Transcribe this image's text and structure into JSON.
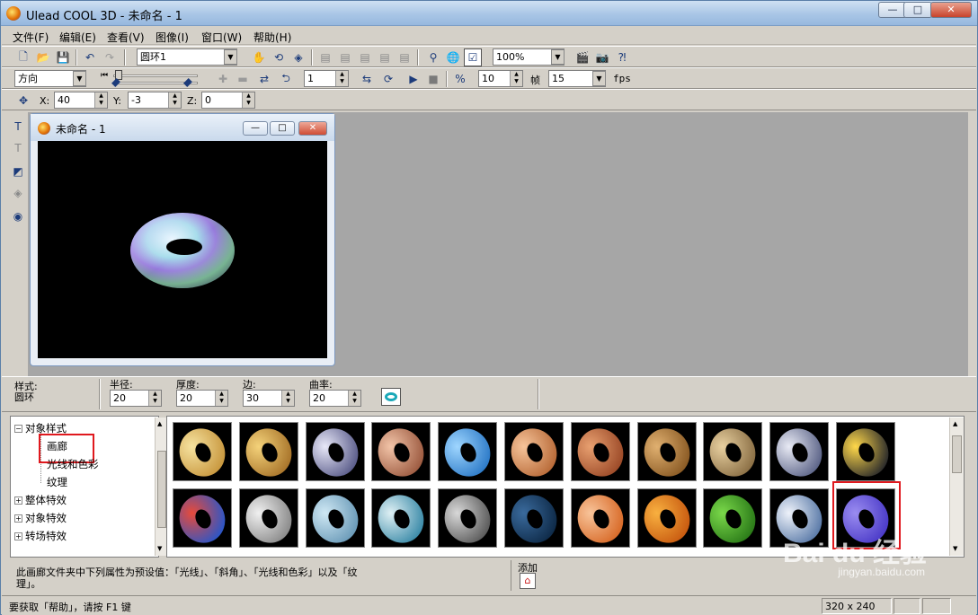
{
  "window": {
    "title": "Ulead COOL 3D - 未命名 - 1",
    "caption_buttons": [
      "—",
      "□",
      "✕"
    ]
  },
  "menu": [
    "文件(F)",
    "编辑(E)",
    "查看(V)",
    "图像(I)",
    "窗口(W)",
    "帮助(H)"
  ],
  "toolbar1": {
    "object_select": "圆环1",
    "zoom": "100%"
  },
  "toolbar2": {
    "mode_select": "方向",
    "frame_value": "1",
    "fps_value": "10",
    "frames_label": "帧",
    "frames_select": "15",
    "fps_label": "fps"
  },
  "toolbar3": {
    "x_label": "X:",
    "x_value": "40",
    "y_label": "Y:",
    "y_value": "-3",
    "z_label": "Z:",
    "z_value": "0"
  },
  "document": {
    "title": "未命名 - 1"
  },
  "props": {
    "style_label": "样式:",
    "style_value": "圆环",
    "radius_label": "半径:",
    "radius_value": "20",
    "thickness_label": "厚度:",
    "thickness_value": "20",
    "sides_label": "边:",
    "sides_value": "30",
    "curvature_label": "曲率:",
    "curvature_value": "20"
  },
  "tree": {
    "root": "对象样式",
    "children": [
      "画廊",
      "光线和色彩",
      "纹理"
    ],
    "others": [
      "整体特效",
      "对象特效",
      "转场特效"
    ]
  },
  "gallery": {
    "thumbs": [
      {
        "c1": "#f6e3a0",
        "c2": "#c8973e"
      },
      {
        "c1": "#f4d27a",
        "c2": "#a8742a"
      },
      {
        "c1": "#e8e8f8",
        "c2": "#5a5c8a"
      },
      {
        "c1": "#f2c4a8",
        "c2": "#9c5a40"
      },
      {
        "c1": "#9fd6ff",
        "c2": "#2c7ac8"
      },
      {
        "c1": "#f6c49a",
        "c2": "#b86a38"
      },
      {
        "c1": "#e8a070",
        "c2": "#9c4a28"
      },
      {
        "c1": "#e0b070",
        "c2": "#8a5a24"
      },
      {
        "c1": "#e8d0a0",
        "c2": "#8a6e44"
      },
      {
        "c1": "#e8eaf4",
        "c2": "#5c6488"
      },
      {
        "c1": "#ffd84a",
        "c2": "#2a2a2a"
      },
      {
        "c1": "#e84a3a",
        "c2": "#2a56c8"
      },
      {
        "c1": "#f0f0f0",
        "c2": "#8a8a8a"
      },
      {
        "c1": "#cfe8f4",
        "c2": "#6a9ab8"
      },
      {
        "c1": "#dff0f4",
        "c2": "#3a8aa8"
      },
      {
        "c1": "#d8d8d8",
        "c2": "#5a5a5a"
      },
      {
        "c1": "#3a6a9c",
        "c2": "#0e2a48"
      },
      {
        "c1": "#f8c49a",
        "c2": "#d86a28"
      },
      {
        "c1": "#f8b040",
        "c2": "#c85a10"
      },
      {
        "c1": "#7ad84a",
        "c2": "#2a7a18"
      },
      {
        "c1": "#eef2fa",
        "c2": "#5a7aa8"
      },
      {
        "c1": "#9a8cf0",
        "c2": "#4a3ac8"
      }
    ]
  },
  "description": {
    "line1": "此画廊文件夹中下列属性为预设值：「光线」、「斜角」、「光线和色彩」以及「纹",
    "line2": "理」。",
    "add_label": "添加"
  },
  "status": {
    "help": "要获取「帮助」，请按 F1 键",
    "size": "320 x 240"
  },
  "watermark": {
    "brand": "Bai du 经验",
    "url": "jingyan.baidu.com"
  }
}
